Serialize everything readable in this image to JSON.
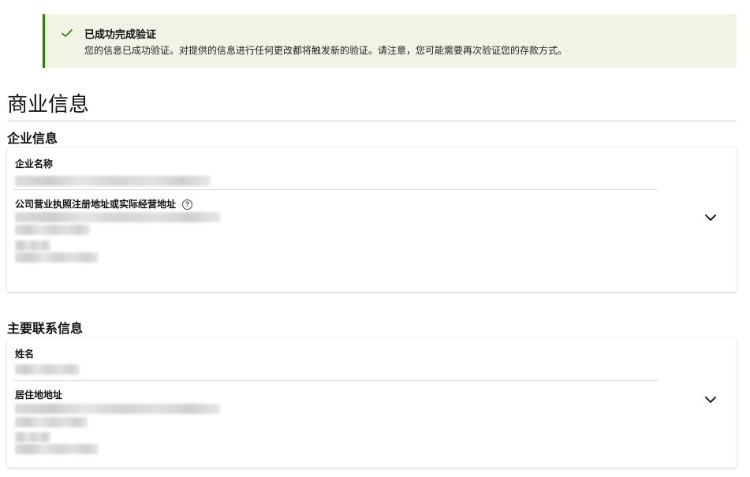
{
  "alert": {
    "title": "已成功完成验证",
    "message": "您的信息已成功验证。对提供的信息进行任何更改都将触发新的验证。请注意，您可能需要再次验证您的存款方式。",
    "icon": "checkmark-icon",
    "accent_color": "#2b7a0b",
    "background_color": "#f0f4e4"
  },
  "page": {
    "title": "商业信息"
  },
  "business": {
    "heading": "企业信息",
    "company_name_label": "企业名称",
    "address_label": "公司营业执照注册地址或实际经营地址",
    "help_icon": "question-circle-icon",
    "expand_icon": "chevron-down-icon"
  },
  "contact": {
    "heading": "主要联系信息",
    "name_label": "姓名",
    "address_label": "居住地地址",
    "expand_icon": "chevron-down-icon"
  }
}
